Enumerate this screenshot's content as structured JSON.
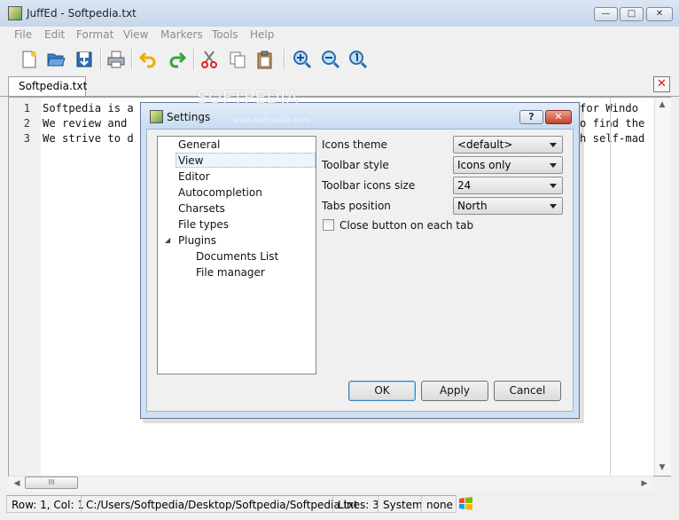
{
  "window": {
    "title": "JuffEd - Softpedia.txt",
    "min_glyph": "—",
    "max_glyph": "□",
    "close_glyph": "✕"
  },
  "menu": [
    "File",
    "Edit",
    "Format",
    "View",
    "Markers",
    "Tools",
    "Help"
  ],
  "toolbar": {
    "icons": [
      "new-file-icon",
      "open-folder-icon",
      "save-icon",
      "print-icon",
      "undo-icon",
      "redo-icon",
      "cut-icon",
      "copy-icon",
      "paste-icon",
      "zoom-in-icon",
      "zoom-out-icon",
      "zoom-reset-icon"
    ]
  },
  "tab": {
    "label": "Softpedia.txt",
    "close_glyph": "✕"
  },
  "editor": {
    "line_numbers": [
      "1",
      "2",
      "3"
    ],
    "lines": [
      "Softpedia is a",
      "We review and",
      "We strive to d"
    ],
    "lines_right": [
      "for Windo",
      "o find the",
      "h self-mad"
    ]
  },
  "hscroll_thumb": "III",
  "status": {
    "position": "Row: 1, Col: 1",
    "path": "C:/Users/Softpedia/Desktop/Softpedia/Softpedia.txt",
    "lines": "Lines: 3",
    "charset": "System",
    "syntax": "none"
  },
  "watermark": {
    "main": "SOFTPEDIA",
    "sub": "www.softpedia.com"
  },
  "dialog": {
    "title": "Settings",
    "help_glyph": "?",
    "close_glyph": "✕",
    "tree": [
      {
        "label": "General",
        "selected": false
      },
      {
        "label": "View",
        "selected": true
      },
      {
        "label": "Editor",
        "selected": false
      },
      {
        "label": "Autocompletion",
        "selected": false
      },
      {
        "label": "Charsets",
        "selected": false
      },
      {
        "label": "File types",
        "selected": false
      },
      {
        "label": "Plugins",
        "selected": false
      },
      {
        "label": "Documents List",
        "selected": false
      },
      {
        "label": "File manager",
        "selected": false
      }
    ],
    "plugins_expanded_glyph": "◢",
    "options": {
      "icons_theme": {
        "label": "Icons theme",
        "value": "<default>"
      },
      "toolbar_style": {
        "label": "Toolbar style",
        "value": "Icons only"
      },
      "toolbar_icons_size": {
        "label": "Toolbar icons size",
        "value": "24"
      },
      "tabs_position": {
        "label": "Tabs position",
        "value": "North"
      },
      "close_button": {
        "label": "Close button on each tab",
        "checked": false
      }
    },
    "buttons": {
      "ok": "OK",
      "apply": "Apply",
      "cancel": "Cancel"
    }
  }
}
